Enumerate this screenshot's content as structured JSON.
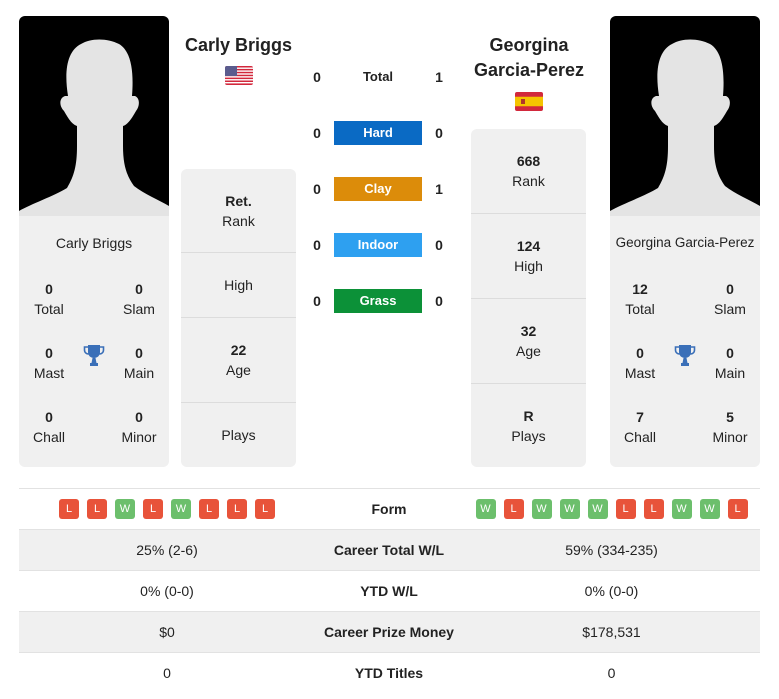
{
  "player1": {
    "name": "Carly Briggs",
    "flag": "usa-flag",
    "info": {
      "rank": {
        "value": "Ret.",
        "label": "Rank"
      },
      "high": {
        "value": "",
        "label": "High"
      },
      "age": {
        "value": "22",
        "label": "Age"
      },
      "plays": {
        "value": "",
        "label": "Plays"
      }
    },
    "titles": {
      "total": {
        "value": "0",
        "label": "Total"
      },
      "slam": {
        "value": "0",
        "label": "Slam"
      },
      "mast": {
        "value": "0",
        "label": "Mast"
      },
      "main": {
        "value": "0",
        "label": "Main"
      },
      "chall": {
        "value": "0",
        "label": "Chall"
      },
      "minor": {
        "value": "0",
        "label": "Minor"
      }
    },
    "form": [
      "L",
      "L",
      "W",
      "L",
      "W",
      "L",
      "L",
      "L"
    ]
  },
  "player2": {
    "name": "Georgina Garcia-Perez",
    "name_line1": "Georgina",
    "name_line2": "Garcia-Perez",
    "flag": "spain-flag",
    "info": {
      "rank": {
        "value": "668",
        "label": "Rank"
      },
      "high": {
        "value": "124",
        "label": "High"
      },
      "age": {
        "value": "32",
        "label": "Age"
      },
      "plays": {
        "value": "R",
        "label": "Plays"
      }
    },
    "titles": {
      "total": {
        "value": "12",
        "label": "Total"
      },
      "slam": {
        "value": "0",
        "label": "Slam"
      },
      "mast": {
        "value": "0",
        "label": "Mast"
      },
      "main": {
        "value": "0",
        "label": "Main"
      },
      "chall": {
        "value": "7",
        "label": "Chall"
      },
      "minor": {
        "value": "5",
        "label": "Minor"
      }
    },
    "form": [
      "W",
      "L",
      "W",
      "W",
      "W",
      "L",
      "L",
      "W",
      "W",
      "L"
    ]
  },
  "h2h": [
    {
      "label": "Total",
      "p1": "0",
      "p2": "1",
      "color": ""
    },
    {
      "label": "Hard",
      "p1": "0",
      "p2": "0",
      "color": "#0a6ac4"
    },
    {
      "label": "Clay",
      "p1": "0",
      "p2": "1",
      "color": "#dc8c0a"
    },
    {
      "label": "Indoor",
      "p1": "0",
      "p2": "0",
      "color": "#2ea0f0"
    },
    {
      "label": "Grass",
      "p1": "0",
      "p2": "0",
      "color": "#0c9138"
    }
  ],
  "table": {
    "form_label": "Form",
    "rows": [
      {
        "label": "Career Total W/L",
        "p1": "25% (2-6)",
        "p2": "59% (334-235)"
      },
      {
        "label": "YTD W/L",
        "p1": "0% (0-0)",
        "p2": "0% (0-0)"
      },
      {
        "label": "Career Prize Money",
        "p1": "$0",
        "p2": "$178,531"
      },
      {
        "label": "YTD Titles",
        "p1": "0",
        "p2": "0"
      }
    ]
  }
}
